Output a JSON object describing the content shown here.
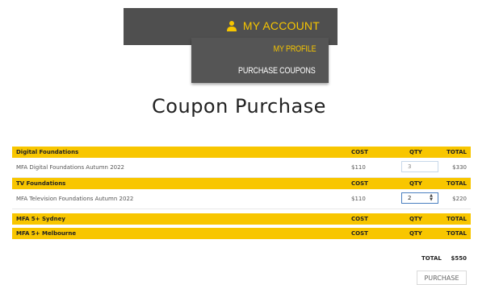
{
  "nav": {
    "account_label": "MY ACCOUNT",
    "accent_color": "#f6c500",
    "menu": [
      {
        "label": "MY PROFILE"
      },
      {
        "label": "PURCHASE COUPONS"
      }
    ]
  },
  "page": {
    "title": "Coupon Purchase"
  },
  "columns": {
    "cost": "COST",
    "qty": "QTY",
    "total": "TOTAL"
  },
  "sections": [
    {
      "name": "Digital Foundations",
      "items": [
        {
          "name": "MFA Digital Foundations Autumn 2022",
          "cost": "$110",
          "qty": "3",
          "total": "$330"
        }
      ]
    },
    {
      "name": "TV Foundations",
      "items": [
        {
          "name": "MFA Television Foundations Autumn 2022",
          "cost": "$110",
          "qty": "2",
          "total": "$220"
        }
      ]
    },
    {
      "name": "MFA 5+ Sydney",
      "items": []
    },
    {
      "name": "MFA 5+ Melbourne",
      "items": []
    }
  ],
  "summary": {
    "label": "TOTAL",
    "value": "$550"
  },
  "purchase_label": "PURCHASE"
}
